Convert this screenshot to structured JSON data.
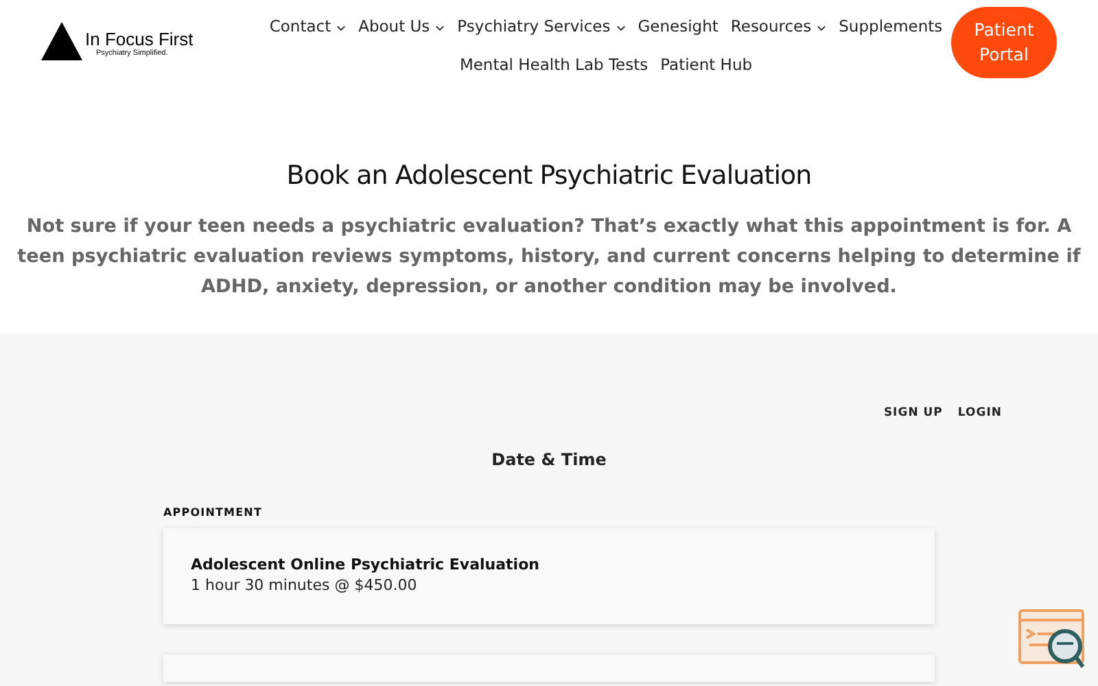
{
  "logo": {
    "name": "In Focus First",
    "tagline": "Psychiatry Simplified."
  },
  "nav": [
    {
      "label": "Contact",
      "dropdown": true
    },
    {
      "label": "About Us",
      "dropdown": true
    },
    {
      "label": "Psychiatry Services",
      "dropdown": true
    },
    {
      "label": "Genesight",
      "dropdown": false
    },
    {
      "label": "Resources",
      "dropdown": true
    },
    {
      "label": "Supplements",
      "dropdown": false
    },
    {
      "label": "Mental Health Lab Tests",
      "dropdown": false
    },
    {
      "label": "Patient Hub",
      "dropdown": false
    }
  ],
  "portal_button": "Patient Portal",
  "hero": {
    "title": "Book an Adolescent Psychiatric Evaluation",
    "text": "Not sure if your teen needs a psychiatric evaluation? That’s exactly what this appointment is for. A teen psychiatric evaluation reviews symptoms, history, and current concerns helping to determine if ADHD, anxiety, depression, or another condition may be involved."
  },
  "booking": {
    "account_links": [
      "SIGN UP",
      "LOGIN"
    ],
    "step_title": "Date & Time",
    "section_label": "APPOINTMENT",
    "appointments": [
      {
        "name": "Adolescent Online Psychiatric Evaluation",
        "detail": "1 hour 30 minutes @ $450.00"
      }
    ]
  }
}
